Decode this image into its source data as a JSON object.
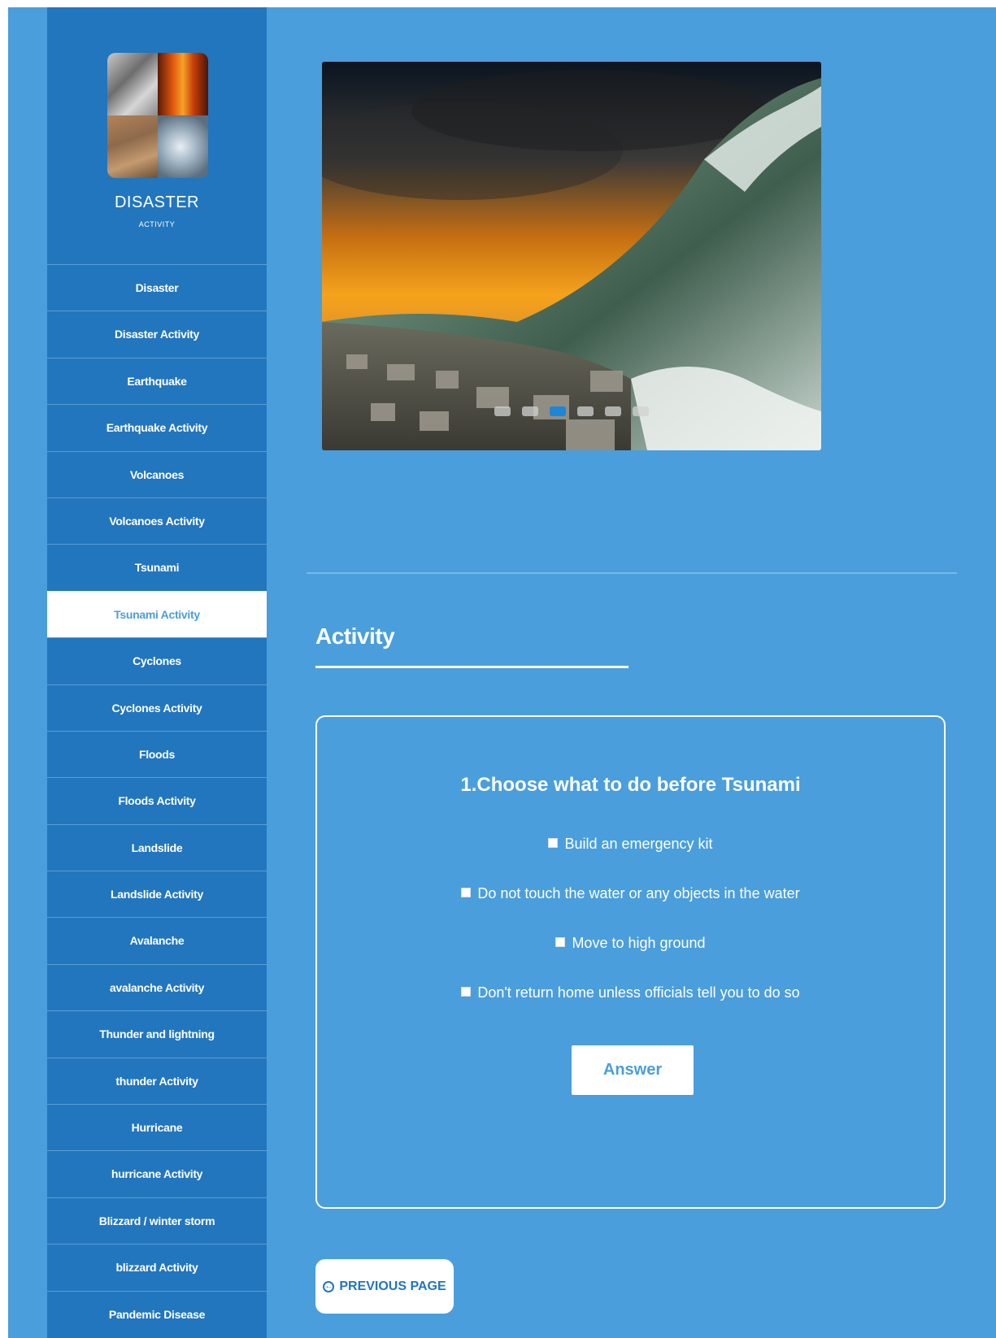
{
  "colors": {
    "page_background": "#4a9edc",
    "sidebar_background": "#2276bd",
    "active_item_background": "#ffffff",
    "active_item_text": "#4a9edc",
    "active_dot": "#1c86d8"
  },
  "sidebar": {
    "brand_title": "DISASTER",
    "brand_subtitle": "ACTIVITY",
    "items": [
      {
        "label": "Disaster"
      },
      {
        "label": "Disaster Activity"
      },
      {
        "label": "Earthquake"
      },
      {
        "label": "Earthquake Activity"
      },
      {
        "label": "Volcanoes"
      },
      {
        "label": "Volcanoes Activity"
      },
      {
        "label": "Tsunami"
      },
      {
        "label": "Tsunami Activity",
        "active": true
      },
      {
        "label": "Cyclones"
      },
      {
        "label": "Cyclones Activity"
      },
      {
        "label": "Floods"
      },
      {
        "label": "Floods Activity"
      },
      {
        "label": "Landslide"
      },
      {
        "label": "Landslide Activity"
      },
      {
        "label": "Avalanche"
      },
      {
        "label": "avalanche Activity"
      },
      {
        "label": "Thunder and lightning"
      },
      {
        "label": "thunder Activity"
      },
      {
        "label": "Hurricane"
      },
      {
        "label": "hurricane Activity"
      },
      {
        "label": "Blizzard / winter storm"
      },
      {
        "label": "blizzard Activity"
      },
      {
        "label": "Pandemic Disease"
      }
    ]
  },
  "slider": {
    "image": "tsunami wave over coastal town",
    "slide_count": 6,
    "active_slide": 3
  },
  "activity": {
    "title": "Activity",
    "question": "1.Choose what to do before Tsunami",
    "options": [
      "Build an emergency kit",
      "Do not touch the water or any objects in the water",
      "Move to high ground",
      "Don't return home unless officials tell you to do so"
    ],
    "answer_label": "Answer"
  },
  "footer": {
    "previous_label": "PREVIOUS PAGE",
    "previous_icon": "circle-arrow-left-icon"
  }
}
